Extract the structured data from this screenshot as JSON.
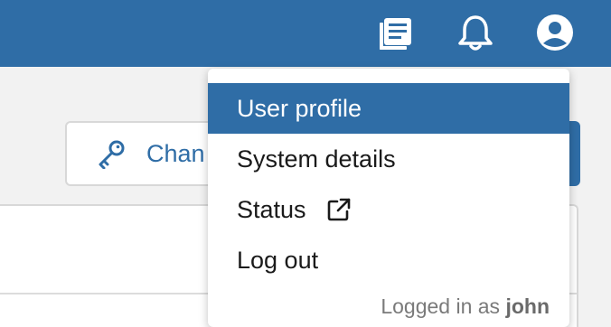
{
  "topbar": {
    "icons": [
      {
        "name": "docs-icon"
      },
      {
        "name": "bell-icon"
      },
      {
        "name": "user-icon"
      }
    ]
  },
  "page": {
    "change_button_label": "Chan"
  },
  "user_menu": {
    "items": [
      {
        "label": "User profile",
        "active": true
      },
      {
        "label": "System details",
        "active": false
      },
      {
        "label": "Status",
        "active": false,
        "icon": "external-link-icon"
      },
      {
        "label": "Log out",
        "active": false
      }
    ],
    "footer_prefix": "Logged in as",
    "footer_user": "john"
  },
  "colors": {
    "brand": "#2f6da6",
    "menu_text": "#1a1a1a",
    "muted": "#7a7a7a"
  }
}
